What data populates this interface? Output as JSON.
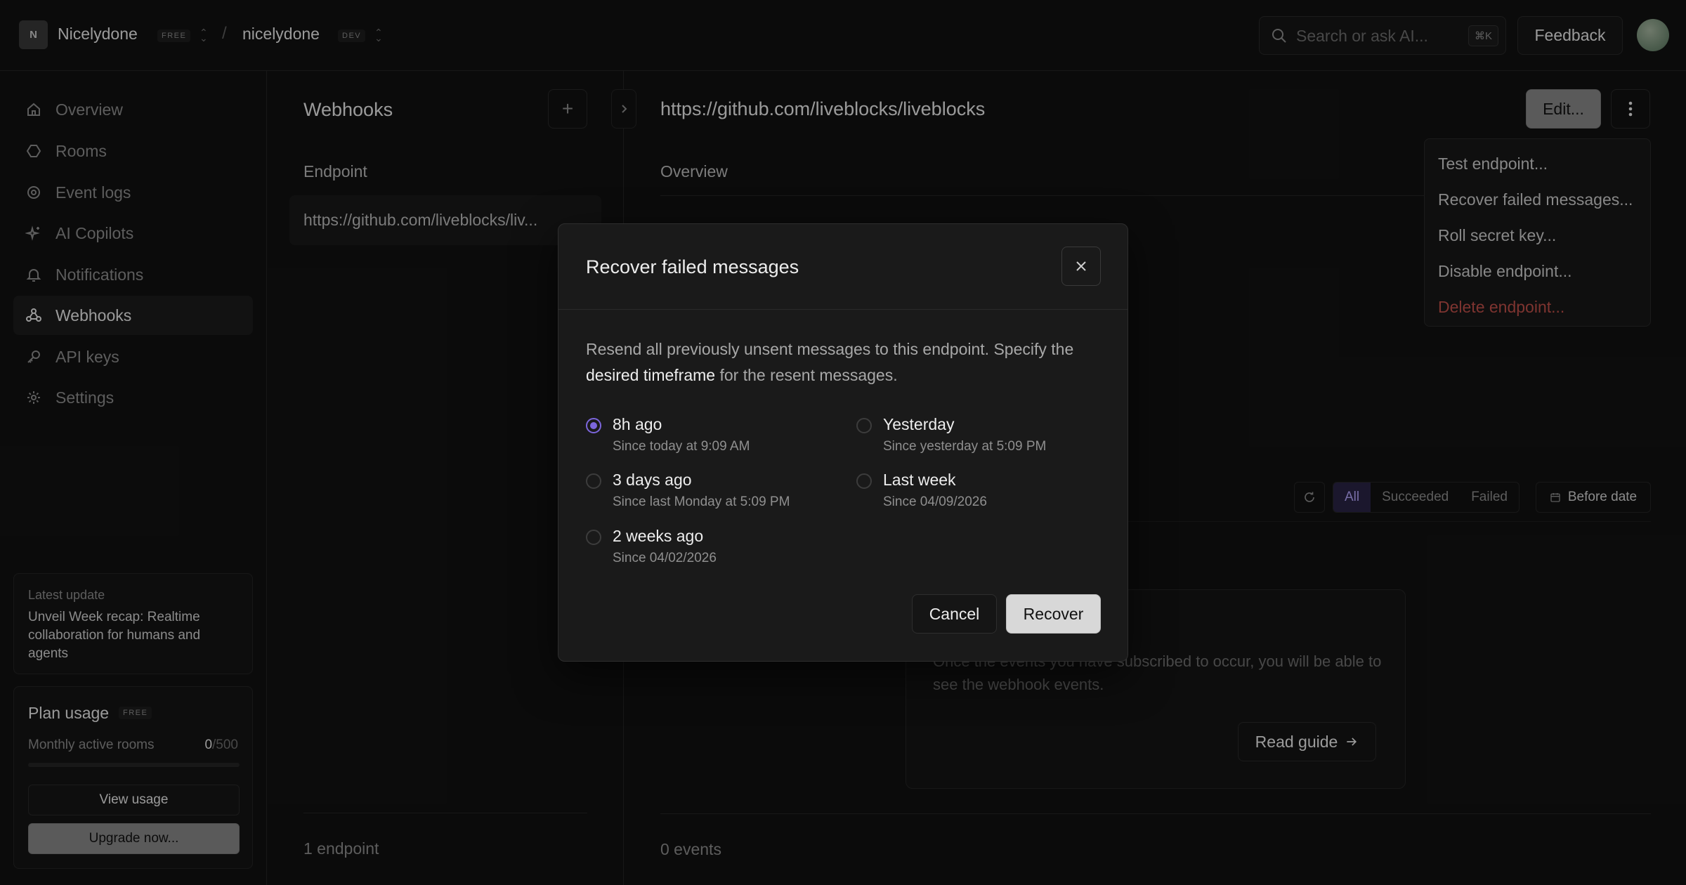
{
  "topbar": {
    "org_initial": "N",
    "org_name": "Nicelydone",
    "org_plan": "FREE",
    "separator": "/",
    "project_name": "nicelydone",
    "project_env": "DEV",
    "search_placeholder": "Search or ask AI...",
    "search_shortcut": "⌘K",
    "feedback_label": "Feedback"
  },
  "sidebar": {
    "items": [
      {
        "label": "Overview",
        "icon": "home-icon"
      },
      {
        "label": "Rooms",
        "icon": "hexagon-icon"
      },
      {
        "label": "Event logs",
        "icon": "target-icon"
      },
      {
        "label": "AI Copilots",
        "icon": "sparkle-icon"
      },
      {
        "label": "Notifications",
        "icon": "bell-icon"
      },
      {
        "label": "Webhooks",
        "icon": "webhook-icon"
      },
      {
        "label": "API keys",
        "icon": "key-icon"
      },
      {
        "label": "Settings",
        "icon": "gear-icon"
      }
    ],
    "update": {
      "label": "Latest update",
      "text": "Unveil Week recap: Realtime collaboration for humans and agents"
    },
    "plan": {
      "title": "Plan usage",
      "badge": "FREE",
      "metric_label": "Monthly active rooms",
      "metric_value": "0",
      "metric_limit": "/500",
      "metric_fraction": 0,
      "view_label": "View usage",
      "upgrade_label": "Upgrade now..."
    }
  },
  "webhooks": {
    "title": "Webhooks",
    "add_label": "+",
    "column_header": "Endpoint",
    "endpoint_url": "https://github.com/liveblocks/liv...",
    "footer": "1 endpoint"
  },
  "detail": {
    "title": "https://github.com/liveblocks/liveblocks",
    "edit_label": "Edit...",
    "tab": "Overview",
    "filters": [
      "All",
      "Succeeded",
      "Failed"
    ],
    "before_date_label": "Before date",
    "empty_desc": "Once the events you have subscribed to occur, you will be able to see the webhook events.",
    "read_guide_label": "Read guide",
    "events_count": "0 events"
  },
  "menu": {
    "items": [
      {
        "label": "Test endpoint..."
      },
      {
        "label": "Recover failed messages..."
      },
      {
        "label": "Roll secret key..."
      },
      {
        "label": "Disable endpoint..."
      },
      {
        "label": "Delete endpoint..."
      }
    ]
  },
  "modal": {
    "title": "Recover failed messages",
    "desc_before": "Resend all previously unsent messages to this endpoint. Specify the ",
    "desc_bold": "desired timeframe",
    "desc_after": " for the resent messages.",
    "options": [
      {
        "label": "8h ago",
        "sub": "Since today at 9:09 AM",
        "selected": true
      },
      {
        "label": "Yesterday",
        "sub": "Since yesterday at 5:09 PM",
        "selected": false
      },
      {
        "label": "3 days ago",
        "sub": "Since last Monday at 5:09 PM",
        "selected": false
      },
      {
        "label": "Last week",
        "sub": "Since 04/09/2026",
        "selected": false
      },
      {
        "label": "2 weeks ago",
        "sub": "Since 04/02/2026",
        "selected": false
      }
    ],
    "cancel_label": "Cancel",
    "recover_label": "Recover"
  },
  "colors": {
    "accent": "#7c66dc",
    "danger": "#c2504a",
    "background": "#121212"
  }
}
